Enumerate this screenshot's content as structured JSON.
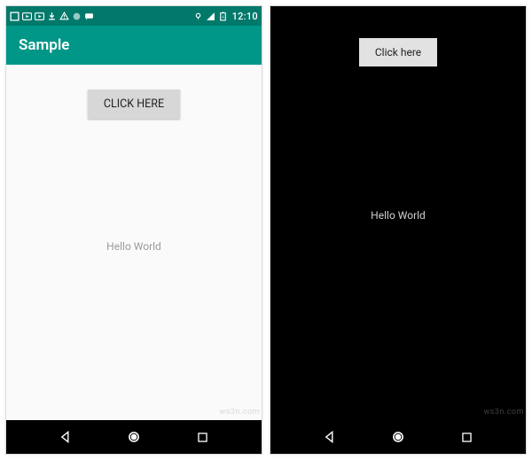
{
  "left": {
    "status": {
      "clock": "12:10"
    },
    "appbar": {
      "title": "Sample"
    },
    "content": {
      "button_label": "CLICK HERE",
      "message": "Hello World"
    },
    "watermark": "ws3n.com"
  },
  "right": {
    "status": {
      "clock": ""
    },
    "content": {
      "button_label": "Click here",
      "message": "Hello World"
    },
    "watermark": "ws3n.com"
  },
  "colors": {
    "primary": "#009688",
    "primary_dark": "#00796B",
    "dark_bg": "#000000",
    "light_bg": "#fafafa",
    "button_bg": "#d7d7d7"
  }
}
